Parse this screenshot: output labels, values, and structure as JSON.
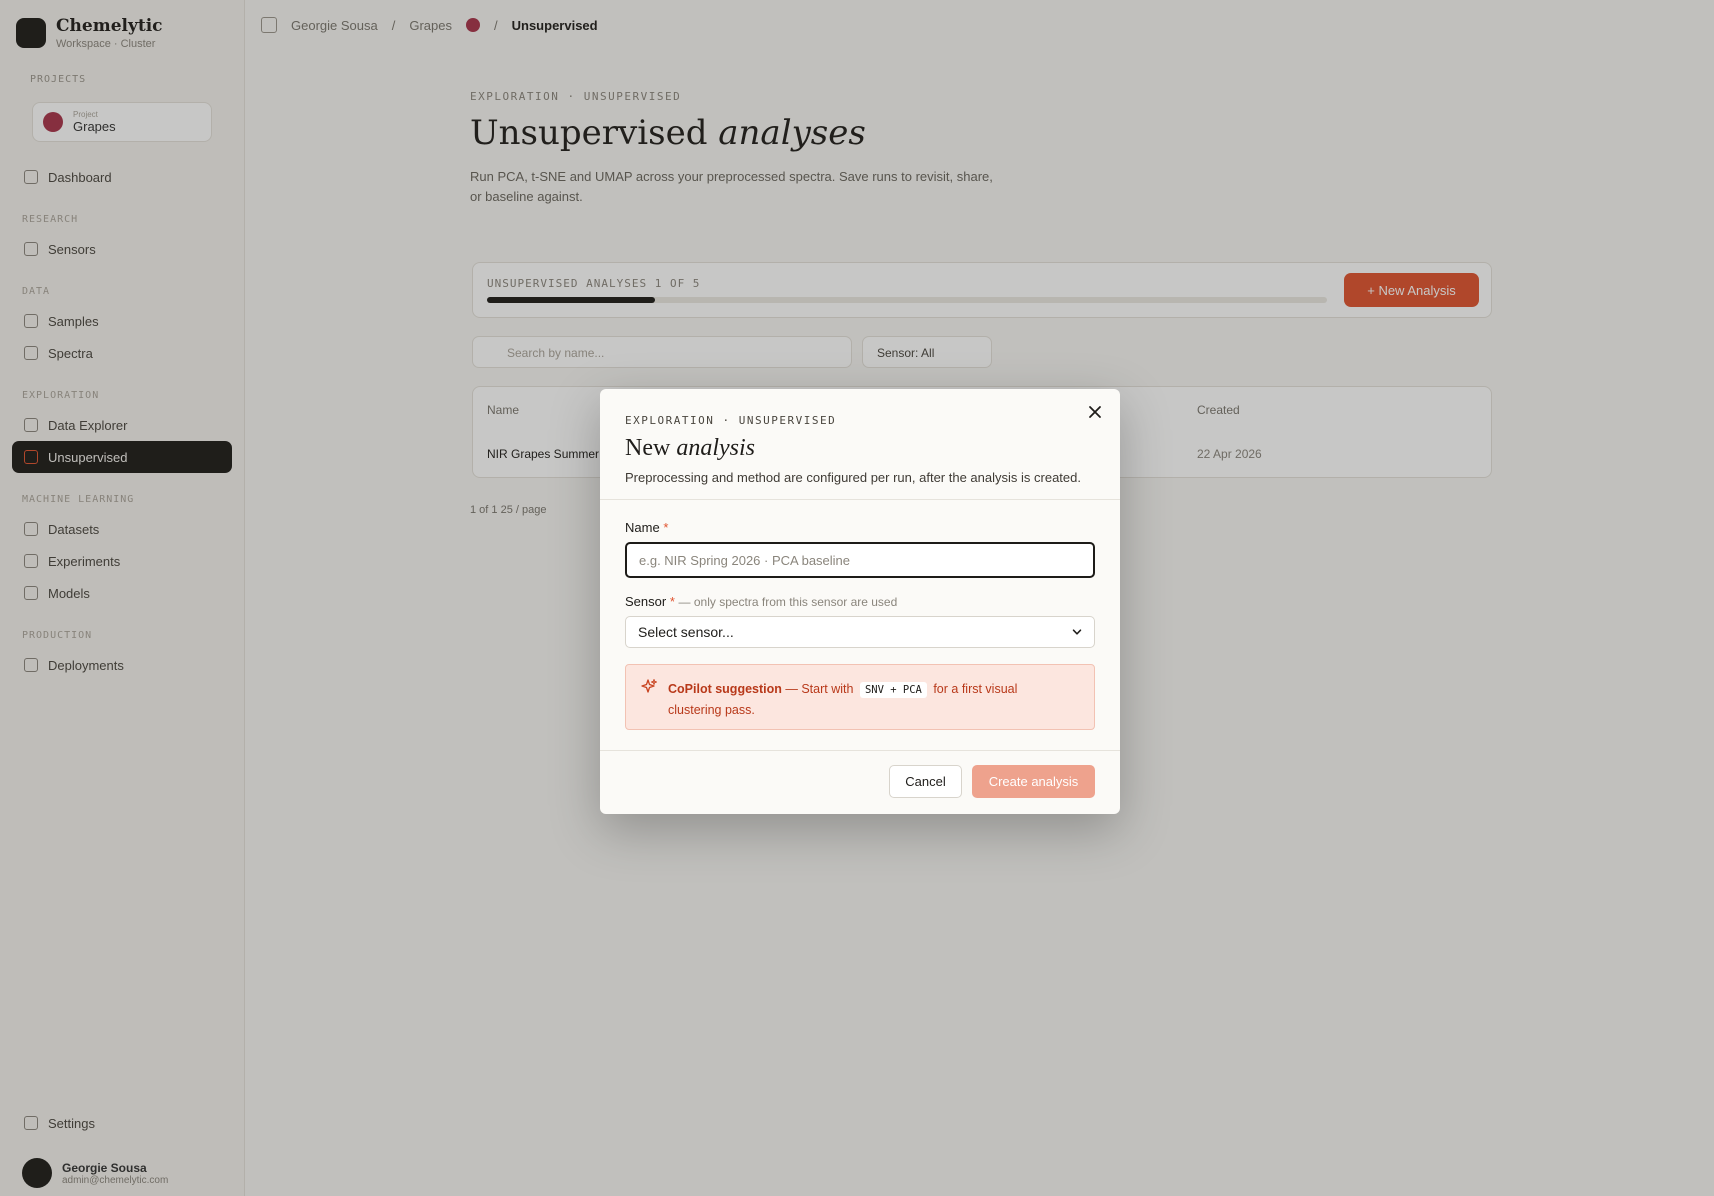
{
  "app": {
    "name": "Chemelytic",
    "subtitle": "Workspace · Cluster",
    "project_label": "PROJECTS",
    "project_small": "Project",
    "project_name": "Grapes",
    "nav": {
      "dashboard": "Dashboard",
      "section_research": "RESEARCH",
      "sensors": "Sensors",
      "section_data": "DATA",
      "samples": "Samples",
      "spectra": "Spectra",
      "section_exploration": "EXPLORATION",
      "data_explorer": "Data Explorer",
      "unsupervised": "Unsupervised",
      "section_ml": "MACHINE LEARNING",
      "datasets": "Datasets",
      "experiments": "Experiments",
      "models": "Models",
      "section_production": "PRODUCTION",
      "deployments": "Deployments",
      "settings": "Settings"
    },
    "user": {
      "name": "Georgie Sousa",
      "email": "admin@chemelytic.com"
    }
  },
  "topbar": {
    "crumb_1": "Georgie Sousa",
    "crumb_2": "Grapes",
    "crumb_current": "Unsupervised"
  },
  "page": {
    "eyebrow": "EXPLORATION · UNSUPERVISED",
    "title_plain": "Unsupervised ",
    "title_italic": "analyses",
    "description": "Run PCA, t-SNE and UMAP across your preprocessed spectra. Save runs to revisit, share, or baseline against.",
    "quota_label": "UNSUPERVISED ANALYSES 1 OF 5",
    "quota_fraction": 0.2,
    "new_button": "+ New Analysis",
    "search_placeholder": "Search by name...",
    "filter_label": "Sensor: All",
    "table": {
      "col_name": "Name",
      "col_created": "Created",
      "row_name": "NIR Grapes Summer",
      "row_created": "22 Apr 2026"
    },
    "pager": "1 of 1   25 / page"
  },
  "modal": {
    "eyebrow": "EXPLORATION · UNSUPERVISED",
    "title_plain": "New ",
    "title_italic": "analysis",
    "description": "Preprocessing and method are configured per run, after the analysis is created.",
    "name_label": "Name",
    "required_mark": "*",
    "name_placeholder": "e.g. NIR Spring 2026 · PCA baseline",
    "sensor_label": "Sensor",
    "sensor_hint": "— only spectra from this sensor are used",
    "sensor_value": "Select sensor...",
    "copilot_title": "CoPilot suggestion",
    "copilot_pre": "— Start with",
    "copilot_code": "SNV + PCA",
    "copilot_post": "for a first visual clustering pass.",
    "cancel_label": "Cancel",
    "create_label": "Create analysis",
    "colors": {
      "accent": "#e0532f",
      "create_disabled": "#eea28d",
      "copilot_bg": "#fce6df"
    }
  }
}
